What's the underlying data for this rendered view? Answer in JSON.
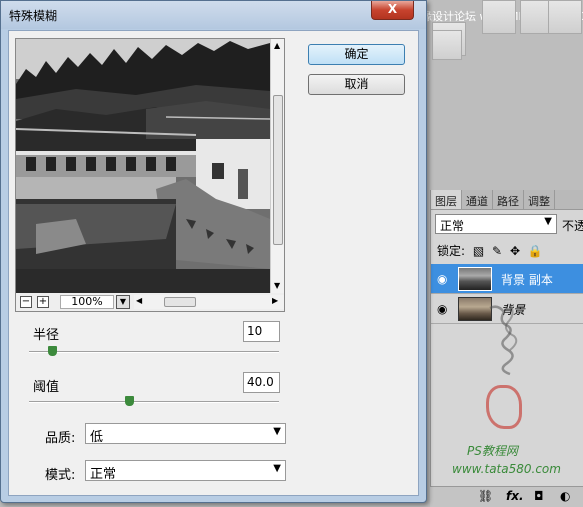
{
  "photoshop": {
    "watermark_top": "思缘设计论坛 www.MISSYUAN.COM",
    "layers_panel": {
      "tabs": [
        "图层",
        "通道",
        "路径",
        "调整"
      ],
      "blend_mode": "正常",
      "opacity_label": "不透",
      "lock_label": "锁定:",
      "layers": [
        {
          "name": "背景 副本",
          "selected": true
        },
        {
          "name": "背景",
          "selected": false
        }
      ],
      "footer_icons": [
        "link-icon",
        "fx-icon",
        "mask-icon",
        "adjustment-icon"
      ],
      "footer_fx": "fx."
    },
    "handwriting_watermark": "我帮你",
    "brand_text": "PS教程网",
    "brand_url": "www.tata580.com"
  },
  "dialog": {
    "title": "特殊模糊",
    "close_label": "X",
    "ok_label": "确定",
    "cancel_label": "取消",
    "zoom": {
      "minus": "−",
      "plus": "+",
      "level": "100%"
    },
    "radius": {
      "label": "半径",
      "value": "10",
      "slider_level": 0.09
    },
    "threshold": {
      "label": "阈值",
      "value": "40.0",
      "slider_level": 0.4
    },
    "quality": {
      "label": "品质:",
      "selected": "低"
    },
    "mode": {
      "label": "模式:",
      "selected": "正常"
    }
  }
}
